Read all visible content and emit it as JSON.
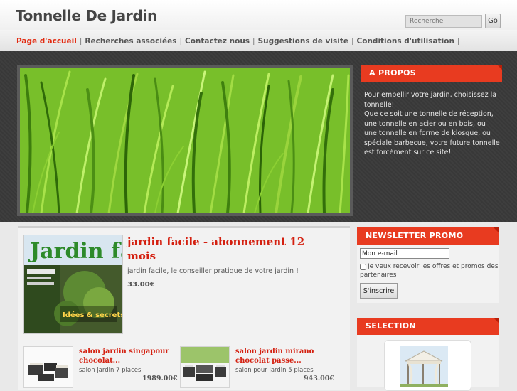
{
  "header": {
    "site_title": "Tonnelle De Jardin",
    "search_placeholder": "Recherche",
    "search_button": "Go"
  },
  "nav": {
    "items": [
      {
        "label": "Page d'accueil",
        "active": true
      },
      {
        "label": "Recherches associées",
        "active": false
      },
      {
        "label": "Contactez nous",
        "active": false
      },
      {
        "label": "Suggestions de visite",
        "active": false
      },
      {
        "label": "Conditions d'utilisation",
        "active": false
      }
    ]
  },
  "about": {
    "heading": "A PROPOS",
    "text_lines": [
      "Pour embellir votre jardin, choisissez la",
      "tonnelle!",
      "Que ce soit une tonnelle de réception,",
      "une tonnelle en acier ou en bois, ou",
      "une tonnelle en forme de kiosque, ou",
      "spéciale barbecue, votre future tonnelle",
      "est forcément sur ce site!"
    ]
  },
  "featured": {
    "magazine_title": "Jardin facile",
    "cover_caption": "Idées & secrets",
    "title": "jardin facile - abonnement 12 mois",
    "description": "jardin facile, le conseiller pratique de votre jardin !",
    "price": "33.00€"
  },
  "products": [
    {
      "title_line1": "salon jardin singapour",
      "title_line2": "chocolat...",
      "subtitle": "salon jardin 7 places",
      "price": "1989.00€"
    },
    {
      "title_line1": "salon jardin mirano",
      "title_line2": "chocolat passe...",
      "subtitle": "salon pour jardin 5 places",
      "price": "943.00€"
    }
  ],
  "newsletter": {
    "heading": "NEWSLETTER PROMO",
    "email_value": "Mon e-mail",
    "checkbox_label": "Je veux recevoir les offres et promos des partenaires",
    "subscribe_button": "S'inscrire"
  },
  "selection": {
    "heading": "SELECTION"
  },
  "colors": {
    "accent": "#e83b20",
    "link_red": "#d42010",
    "dark_band": "#3a3a3a"
  }
}
